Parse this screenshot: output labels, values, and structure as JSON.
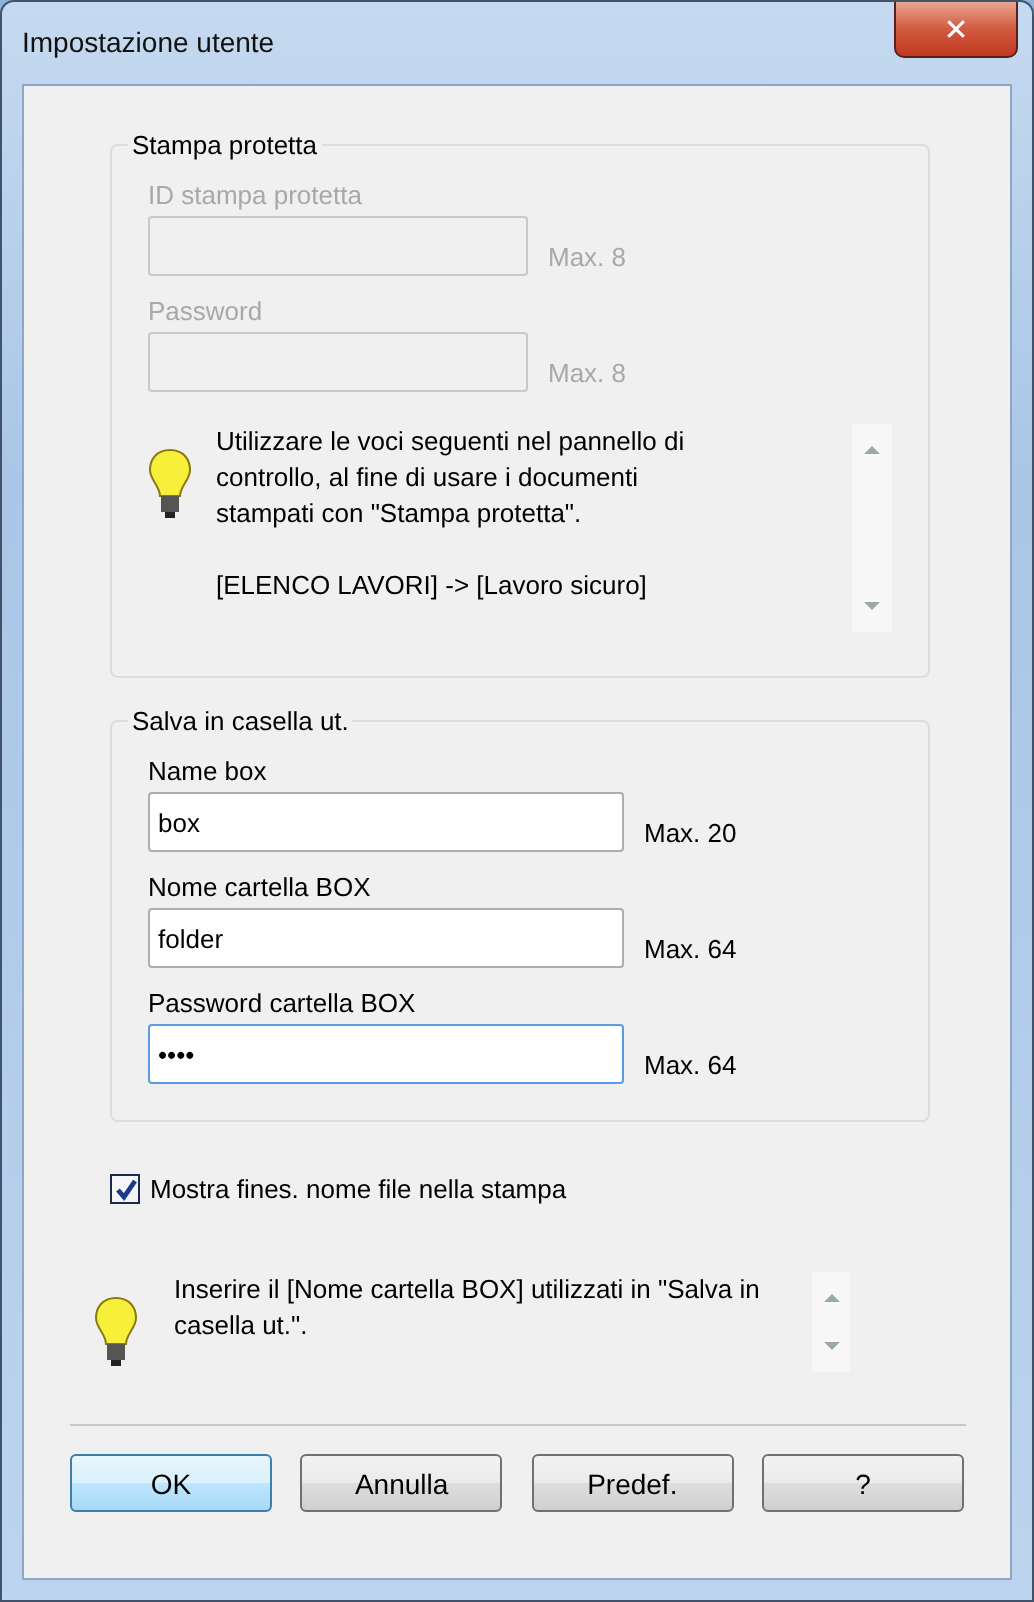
{
  "window": {
    "title": "Impostazione utente",
    "close": "✕"
  },
  "groups": [
    {
      "title": "Stampa protetta",
      "disabled": true,
      "fields": [
        {
          "label": "ID stampa protetta",
          "max": "Max. 8",
          "focused": false
        },
        {
          "label": "Password",
          "max": "Max. 8",
          "focused": false
        }
      ],
      "hint": {
        "paragraphs": [
          "Utilizzare le voci seguenti nel pannello di controllo, al fine di usare i documenti stampati con \"Stampa protetta\".",
          "[ELENCO LAVORI] -> [Lavoro sicuro]"
        ]
      }
    },
    {
      "title": "Salva in casella ut.",
      "disabled": false,
      "fields": [
        {
          "label": "Name box",
          "value": "box",
          "max": "Max. 20",
          "focused": false
        },
        {
          "label": "Nome cartella BOX",
          "value": "folder",
          "max": "Max. 64",
          "focused": false
        },
        {
          "label": "Password cartella BOX",
          "value": "••••",
          "max": "Max. 64",
          "focused": true
        }
      ]
    }
  ],
  "checkbox": {
    "label": "Mostra fines. nome file nella stampa",
    "checked": true
  },
  "hint": {
    "paragraphs": [
      "Inserire il [Nome cartella BOX] utilizzati in \"Salva in casella ut.\"."
    ]
  },
  "buttons": [
    {
      "label": "OK",
      "default": true
    },
    {
      "label": "Annulla",
      "default": false
    },
    {
      "label": "Predef.",
      "default": false
    },
    {
      "label": "?",
      "default": false
    }
  ]
}
